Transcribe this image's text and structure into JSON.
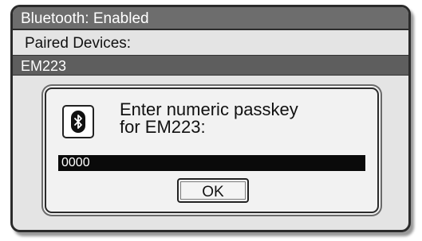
{
  "titlebar": {
    "title": "Bluetooth: Enabled"
  },
  "paired": {
    "label": "Paired Devices:",
    "devices": [
      "EM223"
    ],
    "selected": "EM223"
  },
  "dialog": {
    "icon": "bluetooth-icon",
    "prompt_line1": "Enter numeric passkey",
    "prompt_line2": "for EM223:",
    "passkey_value": "0000",
    "ok_label": "OK"
  }
}
